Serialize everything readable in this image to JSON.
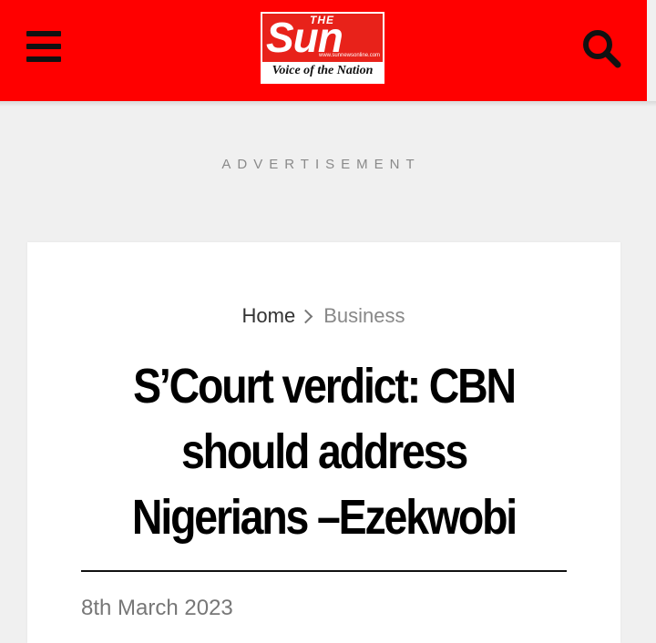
{
  "header": {
    "background_color": "#ff0000",
    "menu_icon": "hamburger-menu-icon",
    "search_icon": "search-icon",
    "logo": {
      "the": "THE",
      "name": "Sun",
      "url": "www.sunnewsonline.com",
      "tagline": "Voice of the Nation"
    }
  },
  "ad": {
    "label": "ADVERTISEMENT"
  },
  "article": {
    "breadcrumb": {
      "home": "Home",
      "section": "Business",
      "separator_icon": "chevron-right-icon"
    },
    "title": "S’Court verdict: CBN should address Nigerians –Ezekwobi",
    "date": "8th March 2023"
  }
}
